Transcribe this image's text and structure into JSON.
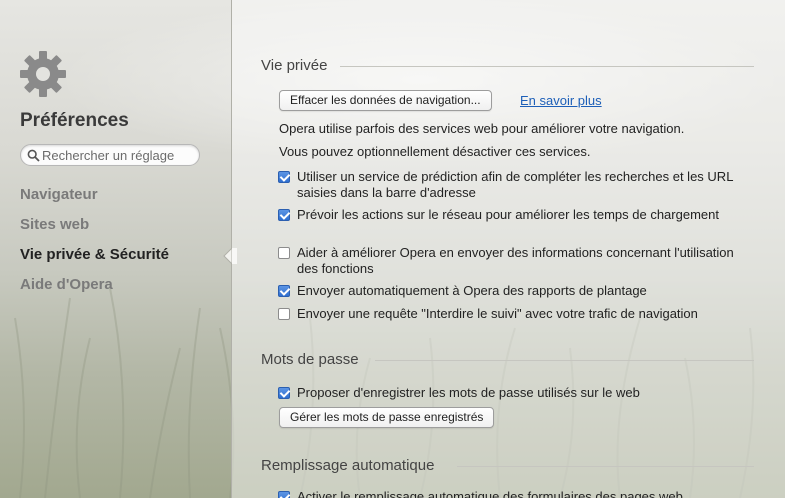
{
  "sidebar": {
    "title": "Préférences",
    "search_placeholder": "Rechercher un réglage",
    "items": [
      {
        "label": "Navigateur",
        "active": false
      },
      {
        "label": "Sites web",
        "active": false
      },
      {
        "label": "Vie privée & Sécurité",
        "active": true
      },
      {
        "label": "Aide d'Opera",
        "active": false
      }
    ]
  },
  "privacy": {
    "title": "Vie privée",
    "clear_button": "Effacer les données de navigation...",
    "learn_more": "En savoir plus",
    "info_line1": "Opera utilise parfois des services web pour améliorer votre navigation.",
    "info_line2": "Vous pouvez optionnellement désactiver ces services.",
    "options": [
      {
        "label": "Utiliser un service de prédiction afin de compléter les recherches et les URL saisies dans la barre d'adresse",
        "checked": true
      },
      {
        "label": "Prévoir les actions sur le réseau pour améliorer les temps de chargement",
        "checked": true
      },
      {
        "label": "Aider à améliorer Opera en envoyer des informations concernant l'utilisation des fonctions",
        "checked": false
      },
      {
        "label": "Envoyer automatiquement à Opera des rapports de plantage",
        "checked": true
      },
      {
        "label": "Envoyer une requête \"Interdire le suivi\" avec votre trafic de navigation",
        "checked": false
      }
    ]
  },
  "passwords": {
    "title": "Mots de passe",
    "offer_label": "Proposer d'enregistrer les mots de passe utilisés sur le web",
    "offer_checked": true,
    "manage_button": "Gérer les mots de passe enregistrés"
  },
  "autofill": {
    "title": "Remplissage automatique",
    "enable_label": "Activer le remplissage automatique des formulaires des pages web",
    "enable_checked": true
  },
  "colors": {
    "link": "#1d5fb8",
    "checkbox_checked": "#2f6fd0"
  },
  "icons": {
    "settings": "gear-icon",
    "search": "search-icon"
  }
}
